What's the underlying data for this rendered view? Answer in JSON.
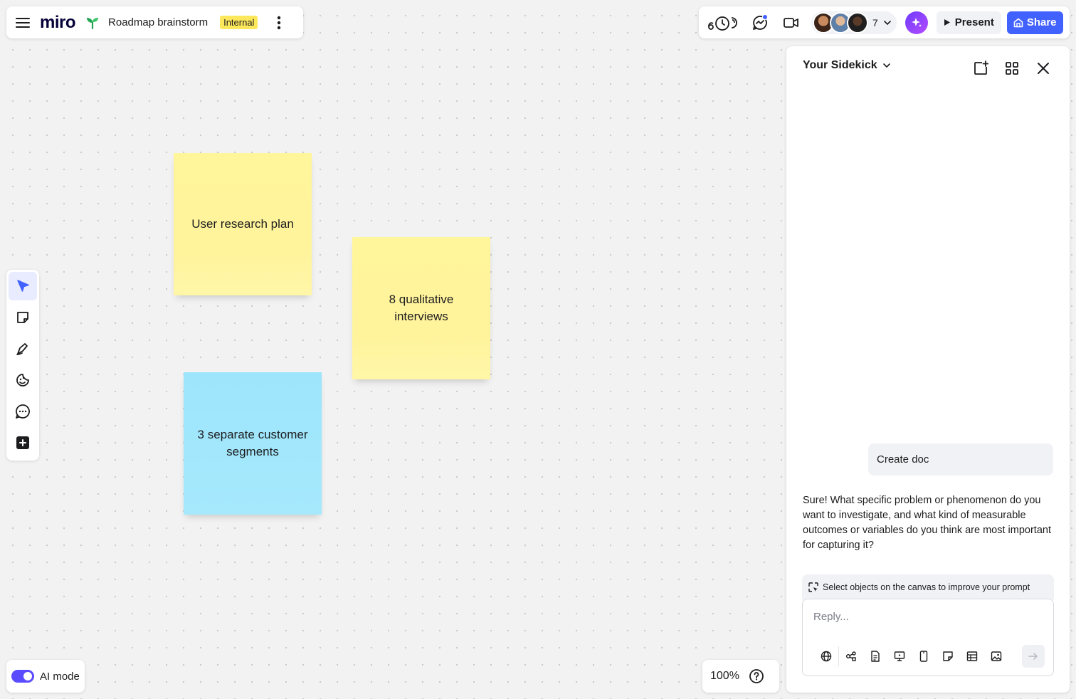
{
  "header": {
    "logo": "miro",
    "board_name": "Roadmap brainstorm",
    "badge": "Internal",
    "collaborator_count": "7",
    "present_label": "Present",
    "share_label": "Share"
  },
  "toolbar": {
    "tools": [
      "select",
      "sticky-note",
      "pen",
      "stickers",
      "comment",
      "add"
    ]
  },
  "canvas": {
    "stickies": [
      {
        "text": "User research plan",
        "color": "#fff59a"
      },
      {
        "text": "8 qualitative interviews",
        "color": "#fff59a"
      },
      {
        "text": "3 separate customer segments",
        "color": "#9de5fb"
      }
    ]
  },
  "footer": {
    "ai_mode_label": "AI mode",
    "ai_mode_on": true,
    "zoom": "100%"
  },
  "sidekick": {
    "title": "Your Sidekick",
    "user_message": "Create doc",
    "ai_message": "Sure! What specific problem or phenomenon do you want to investigate, and what kind of measurable outcomes or variables do you think are most important for capturing it?",
    "hint": "Select objects on the canvas to improve your prompt",
    "reply_placeholder": "Reply..."
  },
  "colors": {
    "accent": "#4262ff",
    "badge": "#fde85b",
    "ai_gradient_start": "#6e3bff"
  }
}
